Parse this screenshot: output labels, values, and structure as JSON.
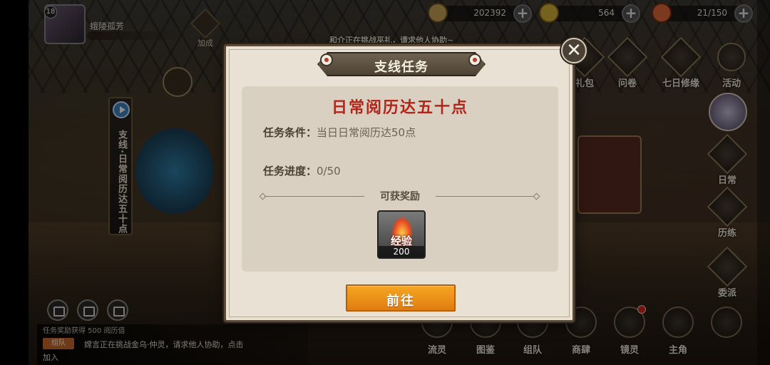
{
  "player": {
    "level": "18",
    "name": "蛾陵孤芳"
  },
  "jiacheng": "加成",
  "resources": [
    {
      "name": "scroll",
      "value": "202392"
    },
    {
      "name": "coin",
      "value": "564"
    },
    {
      "name": "stamina",
      "value": "21/150"
    }
  ],
  "marquee": "和介正在挑战巫礼，请求他人协助~",
  "right_menu_top": [
    "礼包",
    "问卷",
    "七日修缘",
    "活动"
  ],
  "right_menu_side": [
    "日常",
    "历练",
    "委派"
  ],
  "side_task": "支线·日常阅历达五十点",
  "bottom_menu": [
    "流灵",
    "图鉴",
    "组队",
    "商肆",
    "镜灵",
    "主角"
  ],
  "chat": {
    "line0": "任务奖励获得 500 阅历值",
    "tag": "组队",
    "message": "嫦言正在挑战金乌·仲灵，请求他人协助，点击",
    "message2": "加入"
  },
  "dialog": {
    "title": "支线任务",
    "task_name": "日常阅历达五十点",
    "condition_label": "任务条件：",
    "condition_value": "当日日常阅历达50点",
    "progress_label": "任务进度：",
    "progress_value": "0/50",
    "reward_title": "可获奖励",
    "reward": {
      "label": "经验",
      "count": "200"
    },
    "go_button": "前往",
    "close_symbol": "✕"
  }
}
